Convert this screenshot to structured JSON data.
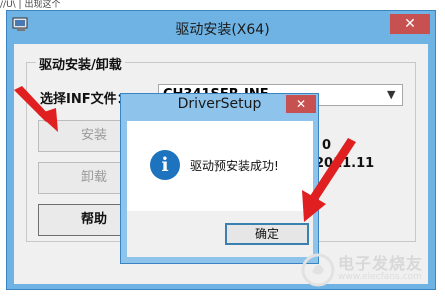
{
  "top_fragment": "//U\\ | 出现这个",
  "window": {
    "title": "驱动安装(X64)",
    "close_glyph": "✕",
    "group_title": "驱动安装/卸载",
    "inf_label": "选择INF文件：",
    "inf_value": "CH341SER.INF",
    "buttons": {
      "install": "安装",
      "uninstall": "卸载",
      "help": "帮助"
    },
    "info_line1": "0",
    "info_line2": "2011.11"
  },
  "dialog": {
    "title": "DriverSetup",
    "close_glyph": "✕",
    "icon": "information-icon",
    "icon_glyph": "i",
    "message": "驱动预安装成功!",
    "ok_label": "确定"
  },
  "watermark": {
    "brand": "电子发烧友",
    "url": "www.elecfans.com"
  },
  "colors": {
    "window_frame": "#6fb3e4",
    "dialog_frame": "#8ec3ec",
    "close_button": "#c75050",
    "annotation_arrow": "#e02020",
    "info_icon": "#1e73be"
  }
}
